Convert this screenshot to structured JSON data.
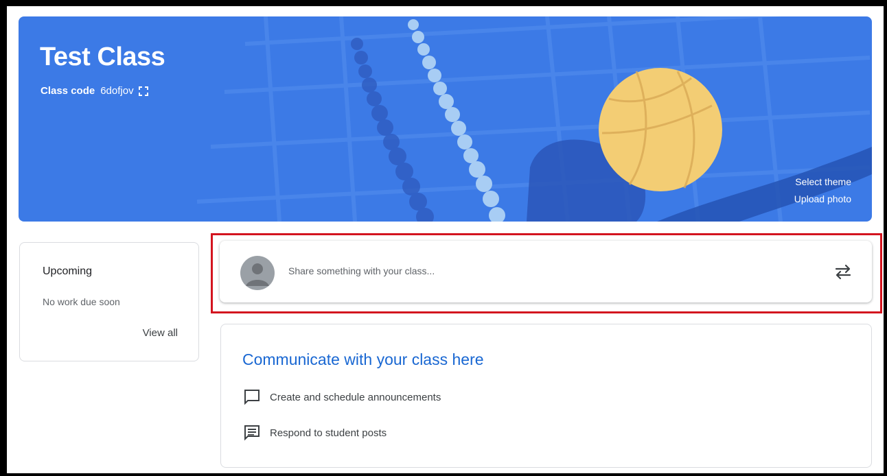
{
  "banner": {
    "title": "Test Class",
    "class_code_label": "Class code",
    "class_code": "6dofjov",
    "select_theme": "Select theme",
    "upload_photo": "Upload photo",
    "background_color": "#3c7ae6"
  },
  "upcoming": {
    "title": "Upcoming",
    "empty_text": "No work due soon",
    "view_all": "View all"
  },
  "share": {
    "placeholder": "Share something with your class..."
  },
  "communicate": {
    "title": "Communicate with your class here",
    "items": [
      {
        "icon": "announcement-icon",
        "label": "Create and schedule announcements"
      },
      {
        "icon": "student-posts-icon",
        "label": "Respond to student posts"
      }
    ]
  },
  "colors": {
    "accent": "#1967d2",
    "highlight": "#d3141f"
  }
}
